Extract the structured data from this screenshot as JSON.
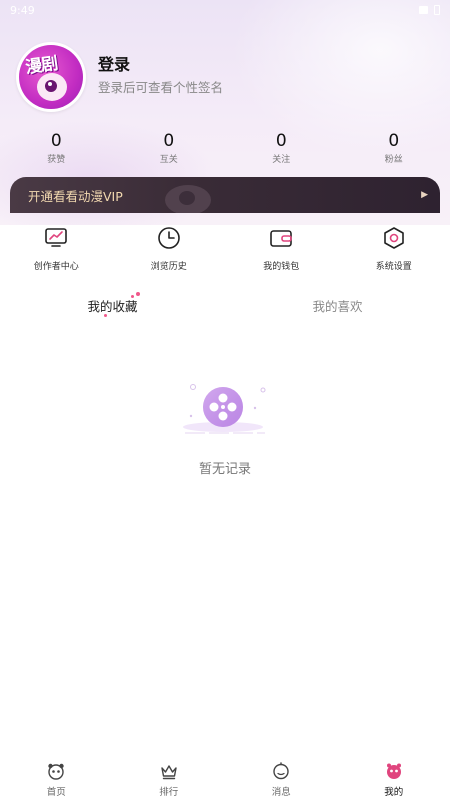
{
  "status_bar": {
    "time": "9:49"
  },
  "profile": {
    "avatar_text": "漫剧",
    "login_title": "登录",
    "login_subtitle": "登录后可查看个性签名"
  },
  "stats": [
    {
      "value": "0",
      "label": "获赞"
    },
    {
      "value": "0",
      "label": "互关"
    },
    {
      "value": "0",
      "label": "关注"
    },
    {
      "value": "0",
      "label": "粉丝"
    }
  ],
  "vip_banner": {
    "text": "开通看看动漫VIP",
    "arrow": "▶"
  },
  "quick_actions": [
    {
      "label": "创作者中心",
      "icon": "creator-chart-icon"
    },
    {
      "label": "浏览历史",
      "icon": "clock-icon"
    },
    {
      "label": "我的钱包",
      "icon": "wallet-icon"
    },
    {
      "label": "系统设置",
      "icon": "settings-hexagon-icon"
    }
  ],
  "tabs": [
    {
      "label": "我的收藏",
      "active": true
    },
    {
      "label": "我的喜欢",
      "active": false
    }
  ],
  "empty_state": {
    "text": "暂无记录",
    "icon": "film-reel-icon"
  },
  "bottom_nav": [
    {
      "label": "首页",
      "icon": "home-panda-icon",
      "active": false
    },
    {
      "label": "排行",
      "icon": "crown-icon",
      "active": false
    },
    {
      "label": "消息",
      "icon": "message-clock-icon",
      "active": false
    },
    {
      "label": "我的",
      "icon": "profile-bug-icon",
      "active": true
    }
  ],
  "colors": {
    "accent": "#f0588b",
    "vip_text": "#f2d9b0",
    "vip_bg": "#3a2c37",
    "active_nav": "#e0457e"
  }
}
